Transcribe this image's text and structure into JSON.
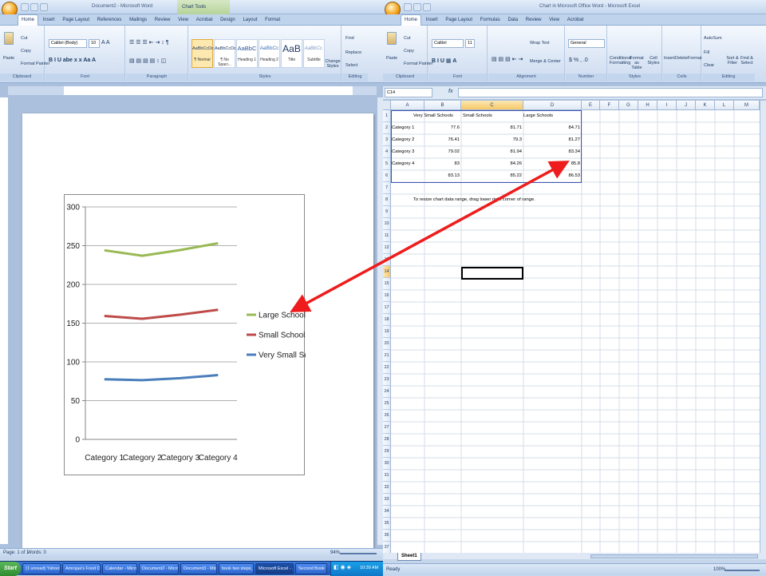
{
  "word": {
    "title": "Document2 - Microsoft Word",
    "context_tab": "Chart Tools",
    "tabs": [
      "Home",
      "Insert",
      "Page Layout",
      "References",
      "Mailings",
      "Review",
      "View",
      "Acrobat",
      "Design",
      "Layout",
      "Format"
    ],
    "clipboard": {
      "paste": "Paste",
      "cut": "Cut",
      "copy": "Copy",
      "format_painter": "Format Painter",
      "label": "Clipboard"
    },
    "font": {
      "name": "Calibri (Body)",
      "size": "10",
      "label": "Font"
    },
    "paragraph_label": "Paragraph",
    "styles": [
      {
        "preview": "AaBbCcDc",
        "name": "¶ Normal"
      },
      {
        "preview": "AaBbCcDc",
        "name": "¶ No Spaci..."
      },
      {
        "preview": "AaBbC",
        "name": "Heading 1"
      },
      {
        "preview": "AaBbCc",
        "name": "Heading 2"
      },
      {
        "preview": "AaB",
        "name": "Title"
      },
      {
        "preview": "AaBbCc.",
        "name": "Subtitle"
      }
    ],
    "change_styles": "Change Styles",
    "styles_label": "Styles",
    "editing": {
      "find": "Find",
      "replace": "Replace",
      "select": "Select",
      "label": "Editing"
    },
    "status": {
      "page": "Page: 1 of 1",
      "words": "Words: 0",
      "zoom": "94%"
    }
  },
  "chart_data": {
    "type": "line",
    "categories": [
      "Category 1",
      "Category 2",
      "Category 3",
      "Category 4"
    ],
    "series": [
      {
        "name": "Very Small Schools",
        "values": [
          77.6,
          76.41,
          79.02,
          83
        ],
        "color": "#4a7ebb"
      },
      {
        "name": "Small Schools",
        "values": [
          159.31,
          155.71,
          160.96,
          167.26
        ],
        "color": "#be4b48"
      },
      {
        "name": "Large Schools",
        "values": [
          244.02,
          236.98,
          244.3,
          253.06
        ],
        "color": "#98b954"
      }
    ],
    "stacked": true,
    "ylim": [
      0,
      300
    ],
    "yticks": [
      "0",
      "50",
      "100",
      "150",
      "200",
      "250",
      "300"
    ],
    "legend_position": "right",
    "grid": true
  },
  "excel": {
    "title": "Chart in Microsoft Office Word - Microsoft Excel",
    "tabs": [
      "Home",
      "Insert",
      "Page Layout",
      "Formulas",
      "Data",
      "Review",
      "View",
      "Acrobat"
    ],
    "clipboard": {
      "paste": "Paste",
      "cut": "Cut",
      "copy": "Copy",
      "format_painter": "Format Painter",
      "label": "Clipboard"
    },
    "font": {
      "name": "Calibri",
      "size": "11",
      "label": "Font"
    },
    "alignment": {
      "wrap": "Wrap Text",
      "merge": "Merge & Center",
      "label": "Alignment"
    },
    "number": {
      "format": "General",
      "label": "Number"
    },
    "styles": {
      "conditional": "Conditional Formatting",
      "table": "Format as Table",
      "cell": "Cell Styles",
      "label": "Styles"
    },
    "cells": {
      "insert": "Insert",
      "delete": "Delete",
      "format": "Format",
      "label": "Cells"
    },
    "editing": {
      "autosum": "AutoSum",
      "fill": "Fill",
      "clear": "Clear",
      "sort": "Sort & Filter",
      "find": "Find & Select",
      "label": "Editing"
    },
    "name_box": "C14",
    "fx": "fx",
    "columns": [
      "A",
      "B",
      "C",
      "D",
      "E",
      "F",
      "G",
      "H",
      "I",
      "J",
      "K",
      "L",
      "M"
    ],
    "header_row": [
      "",
      "Very Small Schools",
      "Small Schools",
      "Large Schools"
    ],
    "rows": [
      [
        "Category 1",
        "77.6",
        "81.71",
        "84.71"
      ],
      [
        "Category 2",
        "76.41",
        "79.3",
        "81.27"
      ],
      [
        "Category 3",
        "79.02",
        "81.94",
        "83.34"
      ],
      [
        "Category 4",
        "83",
        "84.26",
        "85.8"
      ],
      [
        "",
        "83.13",
        "85.22",
        "86.53"
      ]
    ],
    "note": "To resize chart data range, drag lower right corner of range.",
    "sheet": "Sheet1",
    "status": {
      "ready": "Ready",
      "zoom": "100%"
    }
  },
  "taskbar": {
    "start": "Start",
    "items": [
      "(1 unread) Yahoo! ...",
      "Amrojas's Food Dia...",
      "Calendar - Microsof...",
      "Document2 - Micro...",
      "Document3 - Micro...",
      "book two steps_for...",
      "Microsoft Excel - ...",
      "Second Book"
    ],
    "time": "10:39 AM"
  }
}
